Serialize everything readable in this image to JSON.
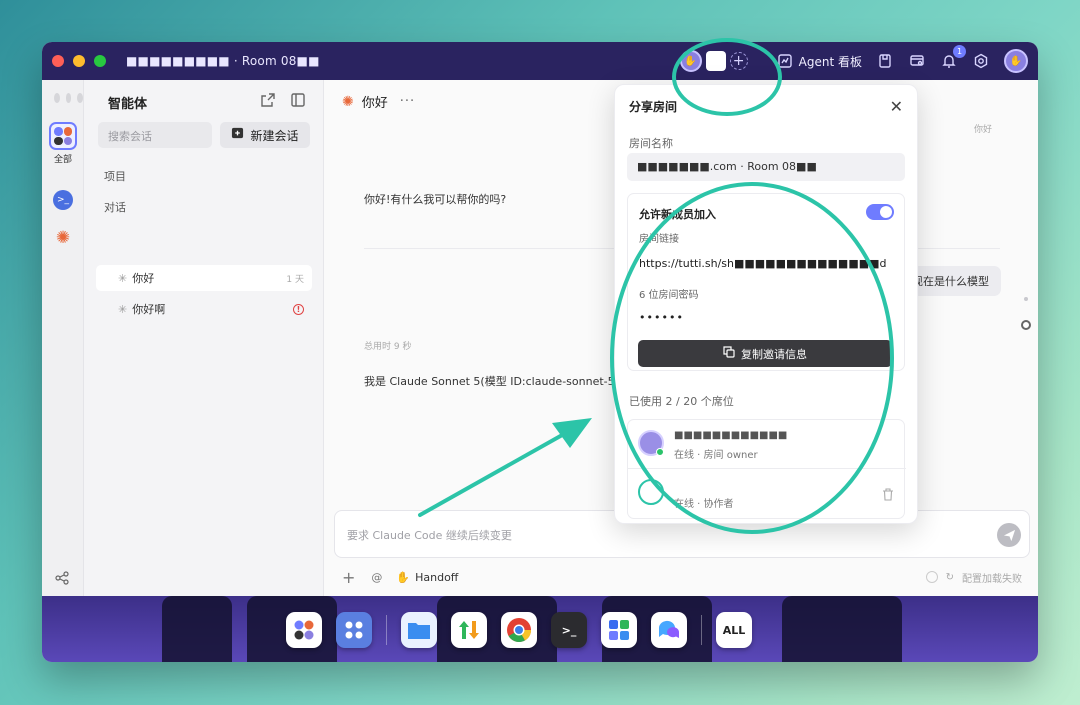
{
  "window": {
    "title": "■■■■■■■■■ · Room 08■■",
    "agent_board_label": "Agent 看板",
    "notification_count": "1"
  },
  "rail": {
    "all_label": "全部"
  },
  "sidebar": {
    "title": "智能体",
    "search_placeholder": "搜索会话",
    "new_chat_label": "新建会话",
    "section_projects": "项目",
    "section_conversations": "对话",
    "conversations": [
      {
        "title": "你好",
        "meta": "1 天"
      },
      {
        "title": "你好啊",
        "meta": "!"
      }
    ]
  },
  "chat": {
    "title": "你好",
    "faint_top": "你好",
    "assistant_msg_1": "你好!有什么我可以帮你的吗?",
    "user_msg": "现在是什么模型",
    "elapsed": "总用时 9 秒",
    "assistant_msg_2": "我是 Claude Sonnet 5(模型 ID:claude-sonnet-5"
  },
  "composer": {
    "placeholder": "要求 Claude Code 继续后续变更",
    "handoff_label": "Handoff",
    "config_status": "配置加载失败"
  },
  "share_popup": {
    "title": "分享房间",
    "room_name_label": "房间名称",
    "room_name_value": "■■■■■■■.com · Room 08■■",
    "allow_join_label": "允许新成员加入",
    "allow_join_enabled": true,
    "room_link_label": "房间链接",
    "room_link_value": "https://tutti.sh/sh■■■■■■■■■■■■■■d",
    "password_label": "6 位房间密码",
    "password_value": "••••••",
    "copy_button_label": "复制邀请信息",
    "seats_used": "已使用 2 / 20 个席位",
    "members": [
      {
        "name": "■■■■■■■■■■■■",
        "role": "在线 · 房间 owner"
      },
      {
        "name": "",
        "role": "在线 · 协作者"
      }
    ]
  },
  "dock": {
    "all_label": "ALL"
  },
  "colors": {
    "accent": "#6f7cff",
    "annotation": "#2cc4a8",
    "titlebar": "#2a2360"
  }
}
